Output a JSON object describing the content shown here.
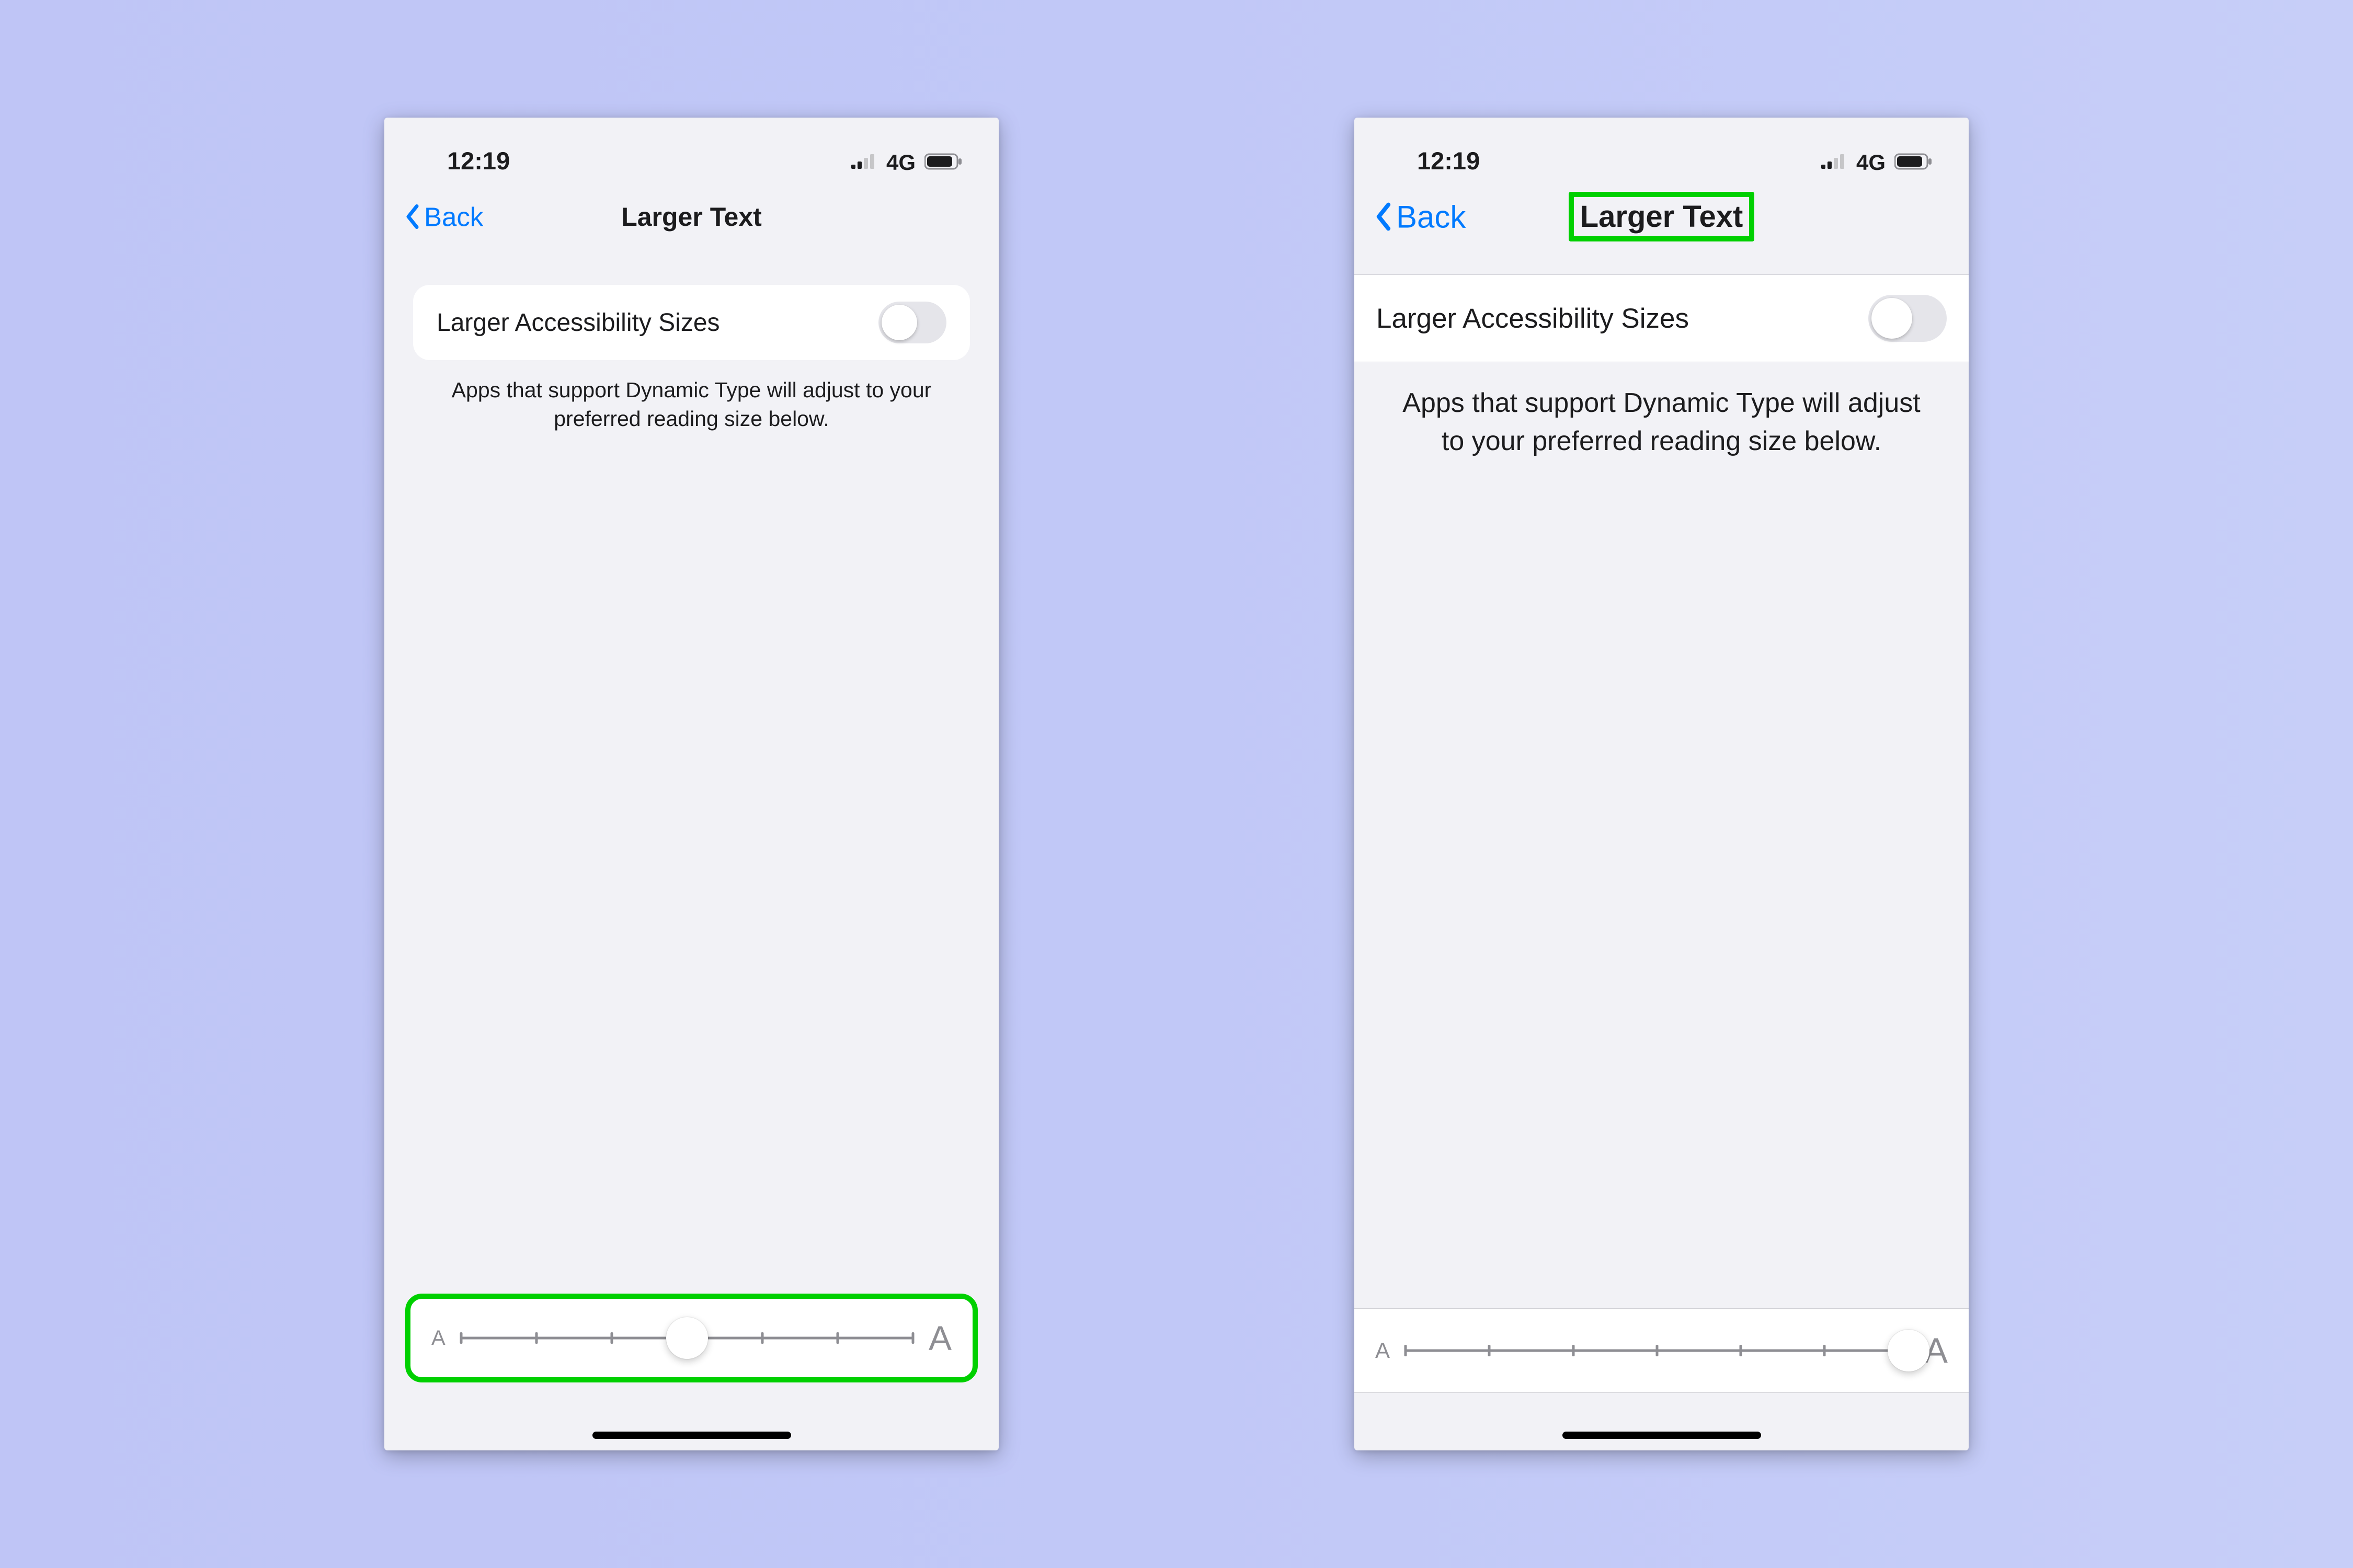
{
  "statusbar": {
    "time": "12:19",
    "network": "4G"
  },
  "nav": {
    "back": "Back",
    "title": "Larger Text"
  },
  "toggle_row": {
    "label": "Larger Accessibility Sizes",
    "on": false
  },
  "footnote": "Apps that support Dynamic Type will adjust to your preferred reading size below.",
  "slider": {
    "min_label": "A",
    "max_label": "A",
    "step_count": 7,
    "value_left": 3,
    "value_right": 6
  },
  "highlights": {
    "left_panel": "slider",
    "right_panel": "title"
  }
}
